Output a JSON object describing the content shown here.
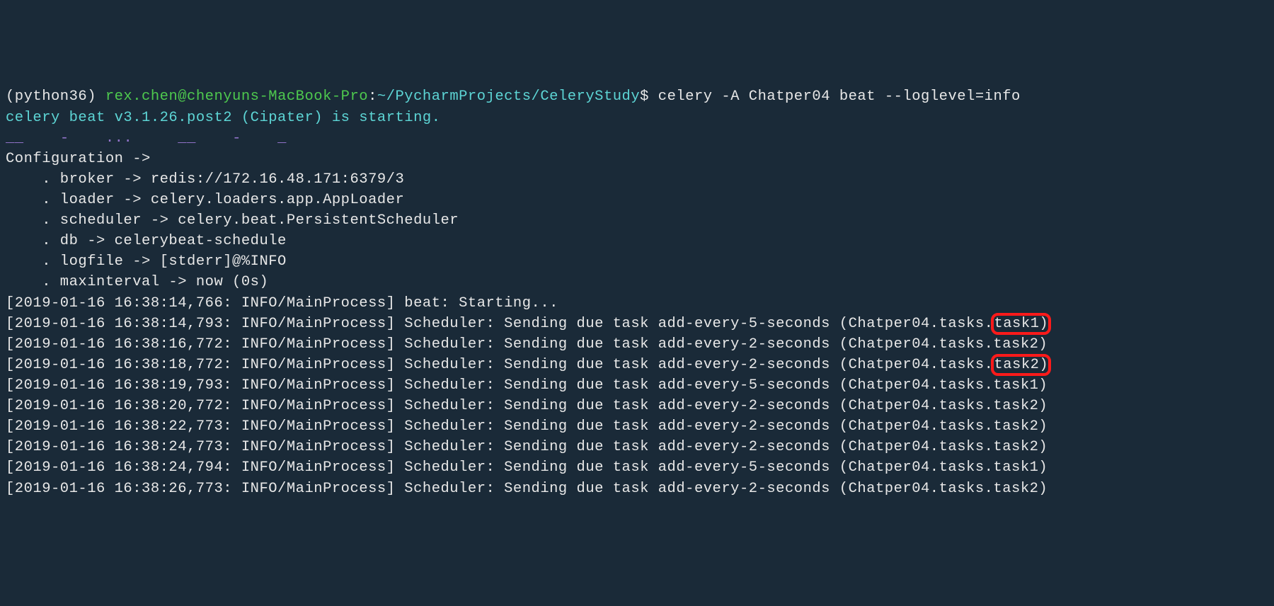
{
  "prompt": {
    "env": "(python36)",
    "user_host": "rex.chen@chenyuns-MacBook-Pro",
    "colon": ":",
    "path": "~/PycharmProjects/CeleryStudy",
    "dollar": "$",
    "command": "celery -A Chatper04 beat --loglevel=info"
  },
  "startup": {
    "line1": "celery beat v3.1.26.post2 (Cipater) is starting.",
    "sep_segments": [
      "__",
      "-",
      "... ",
      "__",
      "-",
      "_"
    ]
  },
  "config": {
    "header": "Configuration ->",
    "broker": "    . broker -> redis://172.16.48.171:6379/3",
    "loader": "    . loader -> celery.loaders.app.AppLoader",
    "scheduler": "    . scheduler -> celery.beat.PersistentScheduler",
    "db": "    . db -> celerybeat-schedule",
    "logfile": "    . logfile -> [stderr]@%INFO",
    "maxinterval": "    . maxinterval -> now (0s)"
  },
  "logs": [
    {
      "ts": "2019-01-16 16:38:14,766",
      "level": "INFO/MainProcess",
      "msg": "beat: Starting..."
    },
    {
      "ts": "2019-01-16 16:38:14,793",
      "level": "INFO/MainProcess",
      "msg": "Scheduler: Sending due task add-every-5-seconds (Chatper04.tasks.",
      "tail": "task1)",
      "hl": true
    },
    {
      "ts": "2019-01-16 16:38:16,772",
      "level": "INFO/MainProcess",
      "msg": "Scheduler: Sending due task add-every-2-seconds (Chatper04.tasks.task2)"
    },
    {
      "ts": "2019-01-16 16:38:18,772",
      "level": "INFO/MainProcess",
      "msg": "Scheduler: Sending due task add-every-2-seconds (Chatper04.tasks.",
      "tail": "task2)",
      "hl": true
    },
    {
      "ts": "2019-01-16 16:38:19,793",
      "level": "INFO/MainProcess",
      "msg": "Scheduler: Sending due task add-every-5-seconds (Chatper04.tasks.task1)"
    },
    {
      "ts": "2019-01-16 16:38:20,772",
      "level": "INFO/MainProcess",
      "msg": "Scheduler: Sending due task add-every-2-seconds (Chatper04.tasks.task2)"
    },
    {
      "ts": "2019-01-16 16:38:22,773",
      "level": "INFO/MainProcess",
      "msg": "Scheduler: Sending due task add-every-2-seconds (Chatper04.tasks.task2)"
    },
    {
      "ts": "2019-01-16 16:38:24,773",
      "level": "INFO/MainProcess",
      "msg": "Scheduler: Sending due task add-every-2-seconds (Chatper04.tasks.task2)"
    },
    {
      "ts": "2019-01-16 16:38:24,794",
      "level": "INFO/MainProcess",
      "msg": "Scheduler: Sending due task add-every-5-seconds (Chatper04.tasks.task1)"
    },
    {
      "ts": "2019-01-16 16:38:26,773",
      "level": "INFO/MainProcess",
      "msg": "Scheduler: Sending due task add-every-2-seconds (Chatper04.tasks.task2)"
    }
  ]
}
